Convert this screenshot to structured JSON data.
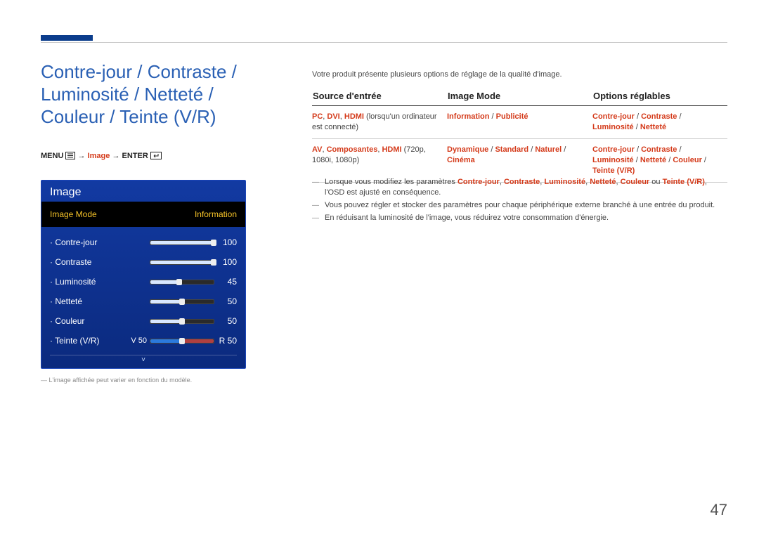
{
  "heading": "Contre-jour / Contraste / Luminosité / Netteté / Couleur / Teinte (V/R)",
  "menu_path": {
    "menu": "MENU",
    "arrow": "→",
    "image": "Image",
    "enter": "ENTER"
  },
  "osd": {
    "title": "Image",
    "selected": {
      "left": "Image Mode",
      "right": "Information"
    },
    "rows": [
      {
        "label": "Contre-jour",
        "value": "100",
        "pct": 100
      },
      {
        "label": "Contraste",
        "value": "100",
        "pct": 100
      },
      {
        "label": "Luminosité",
        "value": "45",
        "pct": 45
      },
      {
        "label": "Netteté",
        "value": "50",
        "pct": 50
      },
      {
        "label": "Couleur",
        "value": "50",
        "pct": 50
      }
    ],
    "vr_row": {
      "label": "Teinte (V/R)",
      "v_prefix": "V",
      "v_value": "50",
      "r_prefix": "R",
      "r_value": "50"
    },
    "chevron": "˅"
  },
  "osd_note": "―   L'image affichée peut varier en fonction du modèle.",
  "intro": "Votre produit présente plusieurs options de réglage de la qualité d'image.",
  "table": {
    "headers": [
      "Source d'entrée",
      "Image Mode",
      "Options réglables"
    ],
    "rows": [
      {
        "c1": {
          "red": "PC, DVI, HDMI",
          "tail": " (lorsqu'un ordinateur est connecté)"
        },
        "c2_parts": [
          "Information",
          " / ",
          "Publicité"
        ],
        "c3_parts": [
          "Contre-jour",
          " / ",
          "Contraste",
          " / ",
          "Luminosité",
          " / ",
          "Netteté"
        ]
      },
      {
        "c1": {
          "red": "AV, Composantes, HDMI",
          "tail": " (720p, 1080i, 1080p)"
        },
        "c2_parts": [
          "Dynamique",
          " / ",
          "Standard",
          " / ",
          "Naturel",
          " / ",
          "Cinéma"
        ],
        "c3_parts": [
          "Contre-jour",
          " / ",
          "Contraste",
          " / ",
          "Luminosité",
          " / ",
          "Netteté",
          " / ",
          "Couleur",
          " / ",
          "Teinte (V/R)"
        ]
      }
    ]
  },
  "notes": [
    {
      "pre": "Lorsque vous modifiez les paramètres ",
      "terms": [
        "Contre-jour",
        "Contraste",
        "Luminosité",
        "Netteté",
        "Couleur"
      ],
      "or": " ou ",
      "last": "Teinte (V/R)",
      "post": ", l'OSD est ajusté en conséquence."
    },
    "Vous pouvez régler et stocker des paramètres pour chaque périphérique externe branché à une entrée du produit.",
    "En réduisant la luminosité de l'image, vous réduirez votre consommation d'énergie."
  ],
  "page_number": "47"
}
